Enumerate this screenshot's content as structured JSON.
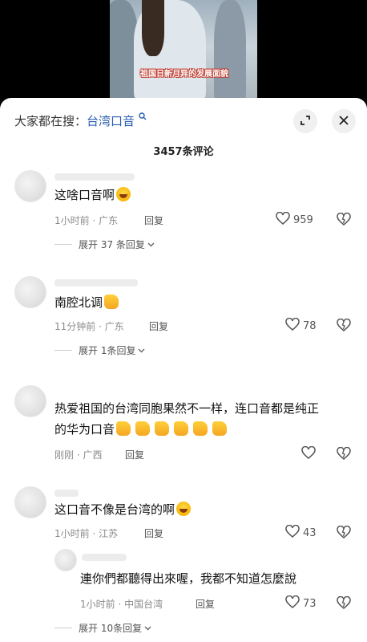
{
  "video": {
    "caption": "祖国日新月异的发展面貌"
  },
  "header": {
    "search_prefix": "大家都在搜：",
    "search_keyword": "台湾口音",
    "comment_count": "3457条评论"
  },
  "comments": [
    {
      "text": "这啥口音啊",
      "time_loc": "1小时前 · 广东",
      "reply": "回复",
      "likes": "959",
      "expand": "展开 37 条回复"
    },
    {
      "text": "南腔北调",
      "time_loc": "11分钟前 · 广东",
      "reply": "回复",
      "likes": "78",
      "expand": "展开 1条回复"
    },
    {
      "text_line1": "热爱祖国的台湾同胞果然不一样，连口音都是纯正",
      "text_line2": "的华为口音",
      "time_loc": "刚刚 · 广西",
      "reply": "回复"
    },
    {
      "text": "这口音不像是台湾的啊",
      "time_loc": "1小时前 · 江苏",
      "reply": "回复",
      "likes": "43"
    },
    {
      "text": "連你們都聽得出來喔，我都不知道怎麼說",
      "time_loc": "1小时前 · 中国台湾",
      "reply": "回复",
      "likes": "73",
      "expand": "展开 10条回复"
    }
  ],
  "icons": {
    "like": "heart-outline-icon",
    "dislike": "broken-heart-icon",
    "search": "search-icon",
    "expand": "expand-icon",
    "close": "close-icon"
  }
}
